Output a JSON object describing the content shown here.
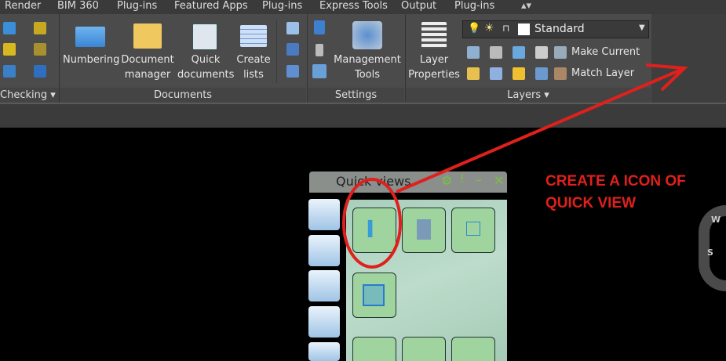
{
  "tabs": [
    "Render",
    "BIM 360",
    "Plug-ins",
    "Featured Apps",
    "Plug-ins",
    "Express Tools",
    "Output",
    "Plug-ins"
  ],
  "panels": {
    "checking": {
      "title": "Checking"
    },
    "documents": {
      "title": "Documents",
      "buttons": [
        {
          "line1": "Numbering",
          "line2": ""
        },
        {
          "line1": "Document",
          "line2": "manager"
        },
        {
          "line1": "Quick",
          "line2": "documents"
        },
        {
          "line1": "Create",
          "line2": "lists"
        }
      ]
    },
    "settings": {
      "title": "Settings",
      "button": {
        "line1": "Management",
        "line2": "Tools"
      }
    },
    "layers": {
      "title": "Layers",
      "button": {
        "line1": "Layer",
        "line2": "Properties"
      },
      "combo_value": "Standard",
      "make_current": "Make Current",
      "match_layer": "Match Layer"
    }
  },
  "quick_views": {
    "title": "Quick views"
  },
  "annotation": {
    "line1": "CREATE A ICON OF",
    "line2": "QUICK VIEW",
    "color": "#e0201c"
  },
  "compass": {
    "w": "W",
    "s": "S"
  }
}
